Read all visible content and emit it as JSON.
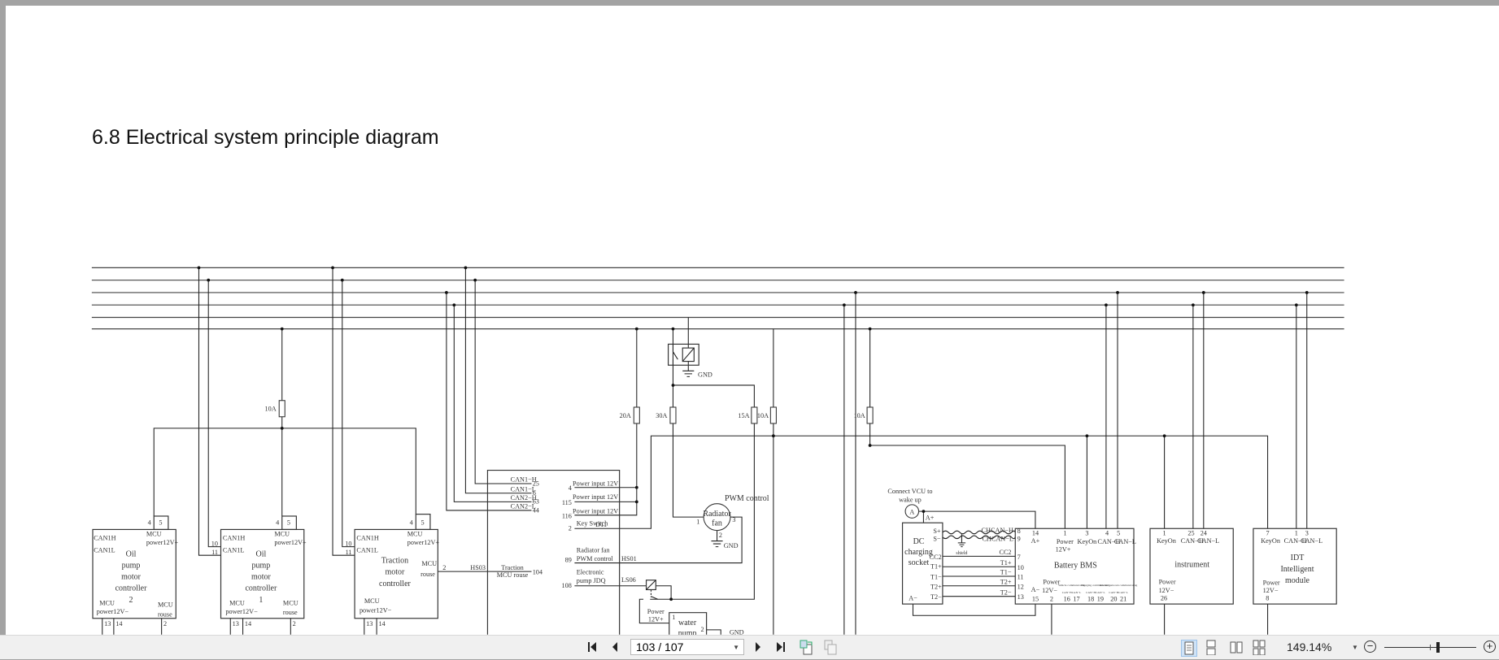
{
  "document": {
    "heading": "6.8 Electrical system principle diagram"
  },
  "diagram": {
    "fuses": {
      "f1": "10A",
      "f2": "20A",
      "f3": "30A",
      "f4": "15A",
      "f5": "10A",
      "f6": "10A"
    },
    "gnd": "GND",
    "oil_pump_2": {
      "can_h": "CAN1H",
      "can_l": "CAN1L",
      "mcu_top": "MCU",
      "power_pos": "power12V+",
      "name": [
        "Oil",
        "pump",
        "motor",
        "controller",
        "2"
      ],
      "mcu_bl": "MCU",
      "power_neg": "power12V−",
      "mcu_br": "MCU",
      "rouse": "rouse",
      "pins": {
        "p4": "4",
        "p5": "5",
        "p13": "13",
        "p14": "14",
        "p2": "2"
      }
    },
    "oil_pump_1": {
      "can_h": "CAN1H",
      "can_l": "CAN1L",
      "mcu_top": "MCU",
      "power_pos": "power12V+",
      "name": [
        "Oil",
        "pump",
        "motor",
        "controller",
        "1"
      ],
      "mcu_bl": "MCU",
      "power_neg": "power12V−",
      "mcu_br": "MCU",
      "rouse": "rouse",
      "pins": {
        "p10": "10",
        "p11": "11",
        "p4": "4",
        "p5": "5",
        "p13": "13",
        "p14": "14",
        "p2": "2"
      }
    },
    "traction": {
      "can_h": "CAN1H",
      "can_l": "CAN1L",
      "mcu_top": "MCU",
      "power_pos": "power12V+",
      "name": [
        "Traction",
        "motor",
        "controller"
      ],
      "mcu_r": "MCU",
      "rouse": "rouse",
      "mcu_bl": "MCU",
      "power_neg": "power12V−",
      "pins": {
        "p10": "10",
        "p11": "11",
        "p4": "4",
        "p5": "5",
        "p2": "2",
        "p13": "13",
        "p14": "14"
      },
      "hs": "HS03"
    },
    "vcu": {
      "can": [
        {
          "label": "CAN1−H",
          "pin": "25"
        },
        {
          "label": "CAN1−L",
          "pin": "6"
        },
        {
          "label": "CAN2−H",
          "pin": "63"
        },
        {
          "label": "CAN2−L",
          "pin": "44"
        }
      ],
      "traction_rouse": [
        "Traction",
        "MCU rouse"
      ],
      "traction_rouse_pin": "104",
      "power_inputs": [
        {
          "label": "Power input 12V",
          "pin": "4"
        },
        {
          "label": "Power input 12V",
          "pin": "115"
        },
        {
          "label": "Power input 12V",
          "pin": "116"
        }
      ],
      "key_switch": {
        "label": "Key Switch",
        "pin": "2",
        "code": "D11"
      },
      "fan_pwm": {
        "label": [
          "Radiator fan",
          "PWM control"
        ],
        "pin": "89",
        "code": "HS01"
      },
      "pump": {
        "label": [
          "Electronic",
          "pump JDQ"
        ],
        "pin": "108",
        "code": "LS06"
      }
    },
    "radiator_fan": {
      "name": [
        "Radiator",
        "fan"
      ],
      "pwm": "PWM control",
      "pins": {
        "p1": "1",
        "p2": "2",
        "p3": "3"
      }
    },
    "water_pump": {
      "power": [
        "Power",
        "12V+"
      ],
      "name": [
        "water",
        "pump"
      ],
      "pins": {
        "p1": "1",
        "p2": "2"
      }
    },
    "dc_socket": {
      "note": [
        "Connect VCU to",
        "wake up"
      ],
      "a_symbol": "A",
      "a_plus": "A+",
      "a_minus": "A−",
      "name": [
        "DC",
        "charging",
        "socket"
      ],
      "pins": [
        "S+",
        "S−",
        "CC2",
        "T1+",
        "T1−",
        "T2+",
        "T2−"
      ],
      "shield": "shield"
    },
    "bms": {
      "name": "Battery BMS",
      "left_labels": [
        "CHCAN−H",
        "CHCAN−L",
        "CC2",
        "T1+",
        "T1−",
        "T2+",
        "T2−"
      ],
      "left_pins": [
        "8",
        "9",
        "7",
        "10",
        "11",
        "12",
        "13"
      ],
      "top": [
        {
          "pin": "14",
          "label": "A+"
        },
        {
          "pin": "1",
          "label": "Power",
          "label2": "12V+"
        },
        {
          "pin": "3",
          "label": "KeyOn"
        },
        {
          "pin": "4",
          "label": "CAN−H"
        },
        {
          "pin": "5",
          "label": "CAN−L"
        }
      ],
      "bottom": {
        "a_minus": "A−",
        "a_minus_pin": "15",
        "power": "Power",
        "power_v": "12V−",
        "power_pin": "2",
        "groups": [
          "Vehicle communicating",
          "Charging communicating",
          "Internal network communicating"
        ],
        "can_labels": [
          "CAN−H",
          "CAN−L",
          "CAN−H",
          "CAN−L",
          "CAN−H",
          "CAN−L"
        ],
        "can_pins": [
          "16",
          "17",
          "18",
          "19",
          "20",
          "21"
        ]
      }
    },
    "instrument": {
      "name": "instrument",
      "top": [
        {
          "pin": "1",
          "label": "KeyOn"
        },
        {
          "pin": "25",
          "label": "CAN−H"
        },
        {
          "pin": "24",
          "label": "CAN−L"
        }
      ],
      "power": [
        "Power",
        "12V−",
        "26"
      ]
    },
    "idt": {
      "name": [
        "IDT",
        "Intelligent",
        "module"
      ],
      "top": [
        {
          "pin": "7",
          "label": "KeyOn"
        },
        {
          "pin": "1",
          "label": "CAN−H"
        },
        {
          "pin": "3",
          "label": "CAN−L"
        }
      ],
      "power": [
        "Power",
        "12V−",
        "8"
      ]
    }
  },
  "toolbar": {
    "page_value": "103 / 107",
    "current_page": 103,
    "total_pages": 107,
    "zoom_label": "149.14%",
    "zoom_minus": "−",
    "zoom_plus": "+",
    "icons": [
      "first-page",
      "previous-page",
      "next-page",
      "last-page",
      "rotate",
      "copy",
      "single-page",
      "continuous",
      "two-page",
      "two-page-continuous"
    ]
  }
}
